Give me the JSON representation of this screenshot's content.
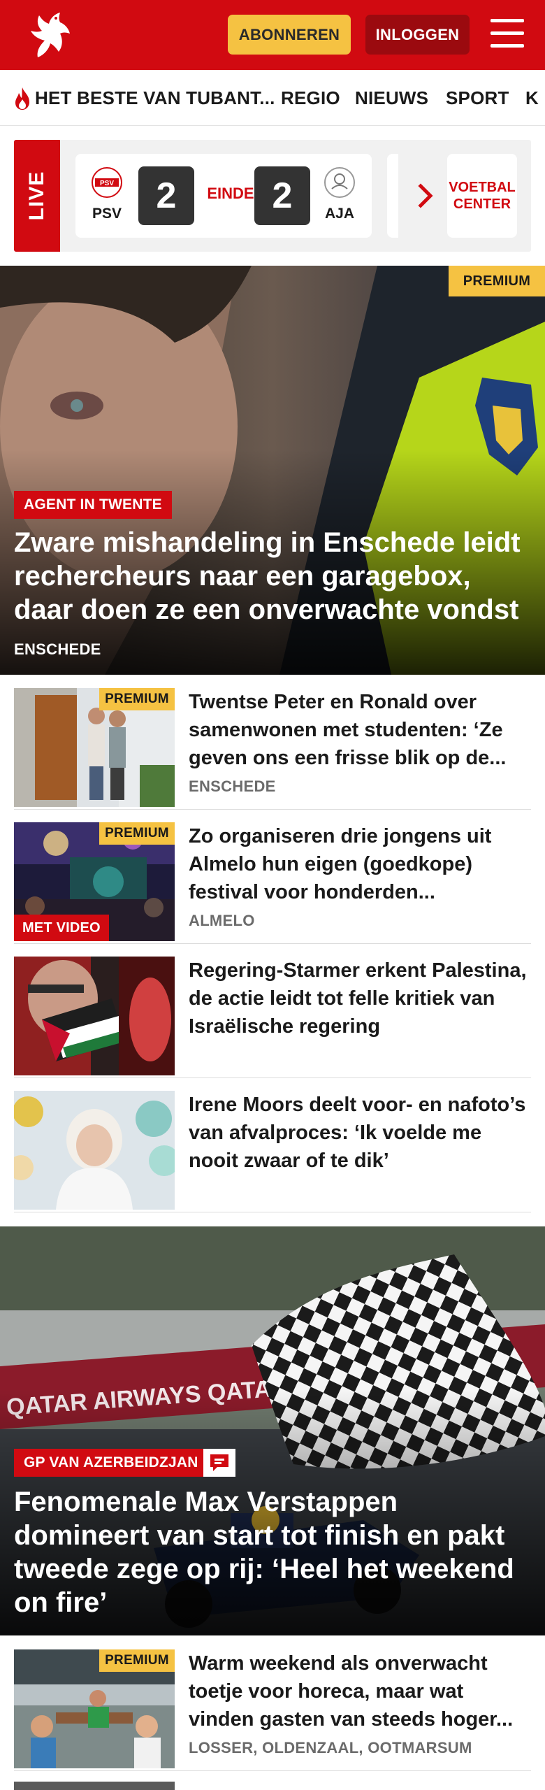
{
  "header": {
    "subscribe_label": "ABONNEREN",
    "login_label": "INLOGGEN",
    "brand_color": "#d10a11",
    "accent_color": "#f5c242"
  },
  "nav": {
    "items": [
      {
        "label": "HET BESTE VAN TUBANT..."
      },
      {
        "label": "REGIO"
      },
      {
        "label": "NIEUWS"
      },
      {
        "label": "SPORT"
      },
      {
        "label": "K"
      }
    ]
  },
  "live": {
    "label": "LIVE",
    "match": {
      "home_team": "PSV",
      "home_score": "2",
      "status": "EINDE",
      "away_score": "2",
      "away_team": "AJA"
    },
    "voetbal_center": "VOETBAL CENTER"
  },
  "hero": {
    "premium": "PREMIUM",
    "label": "AGENT IN TWENTE",
    "title": "Zware mishandeling in Enschede leidt rechercheurs naar een garagebox, daar doen ze een onverwachte vondst",
    "location": "ENSCHEDE"
  },
  "articles": [
    {
      "premium": "PREMIUM",
      "title": "Twentse Peter en Ronald over samenwonen met studenten: ‘Ze geven ons een frisse blik op de...",
      "location": "ENSCHEDE"
    },
    {
      "premium": "PREMIUM",
      "video": "MET VIDEO",
      "title": "Zo organiseren drie jongens uit Almelo hun eigen (goedkope) festival voor honderden...",
      "location": "ALMELO"
    },
    {
      "title": "Regering-Starmer erkent Palestina, de actie leidt tot felle kritiek van Israëlische regering"
    },
    {
      "title": "Irene Moors deelt voor- en nafoto’s van afvalproces: ‘Ik voelde me nooit zwaar of te dik’"
    }
  ],
  "hero2": {
    "label": "GP VAN AZERBEIDZJAN",
    "title": "Fenomenale Max Verstappen domineert van start tot finish en pakt tweede zege op rij: ‘Heel het weekend on fire’"
  },
  "article_last": {
    "premium": "PREMIUM",
    "title": "Warm weekend als onverwacht toetje voor horeca, maar wat vinden gasten van steeds hoger...",
    "location": "LOSSER, OLDENZAAL, OOTMARSUM"
  }
}
